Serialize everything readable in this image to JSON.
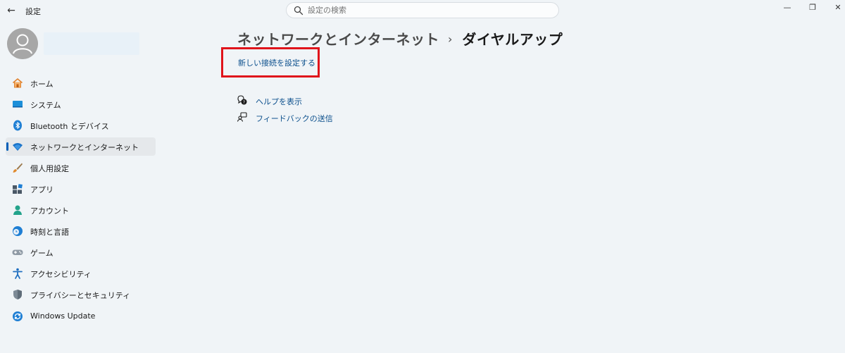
{
  "titlebar": {
    "back_icon": "←",
    "app_title": "設定",
    "minimize_glyph": "—",
    "maximize_glyph": "❐",
    "close_glyph": "✕"
  },
  "search": {
    "placeholder": "設定の検索",
    "icon": "search-icon"
  },
  "profile": {
    "avatar_icon": "person-icon"
  },
  "sidebar": {
    "items": [
      {
        "label": "ホーム",
        "icon": "home-icon"
      },
      {
        "label": "システム",
        "icon": "system-monitor-icon"
      },
      {
        "label": "Bluetooth とデバイス",
        "icon": "bluetooth-icon"
      },
      {
        "label": "ネットワークとインターネット",
        "icon": "wifi-icon",
        "selected": true
      },
      {
        "label": "個人用設定",
        "icon": "paintbrush-icon"
      },
      {
        "label": "アプリ",
        "icon": "apps-icon"
      },
      {
        "label": "アカウント",
        "icon": "account-icon"
      },
      {
        "label": "時刻と言語",
        "icon": "time-language-icon"
      },
      {
        "label": "ゲーム",
        "icon": "gamepad-icon"
      },
      {
        "label": "アクセシビリティ",
        "icon": "accessibility-icon"
      },
      {
        "label": "プライバシーとセキュリティ",
        "icon": "shield-icon"
      },
      {
        "label": "Windows Update",
        "icon": "windows-update-icon"
      }
    ]
  },
  "main": {
    "breadcrumb": {
      "parent": "ネットワークとインターネット",
      "separator": "›",
      "current": "ダイヤルアップ"
    },
    "new_connection_link": "新しい接続を設定する",
    "help_links": [
      {
        "label": "ヘルプを表示",
        "icon": "help-chat-icon"
      },
      {
        "label": "フィードバックの送信",
        "icon": "feedback-icon"
      }
    ]
  },
  "colors": {
    "background": "#f0f4f7",
    "accent": "#005fb8",
    "link": "#0b4f8c",
    "highlight_border": "#e0141b"
  }
}
